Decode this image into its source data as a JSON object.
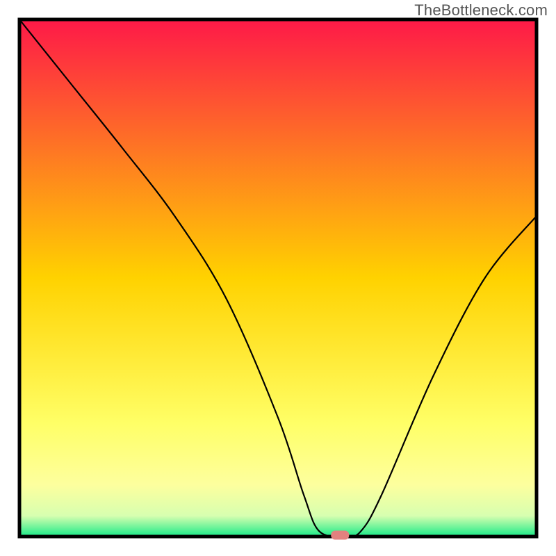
{
  "watermark": "TheBottleneck.com",
  "chart_data": {
    "type": "line",
    "title": "",
    "xlabel": "",
    "ylabel": "",
    "xlim": [
      0,
      100
    ],
    "ylim": [
      0,
      100
    ],
    "x": [
      0,
      10,
      20,
      30,
      40,
      50,
      55,
      58,
      63,
      66,
      70,
      80,
      90,
      100
    ],
    "values": [
      100,
      87.5,
      75,
      62,
      46,
      23,
      8,
      1,
      0,
      1,
      8,
      31,
      50,
      62
    ],
    "curve_description": "percentage bottleneck curve with minimum around x≈62",
    "min_marker": {
      "x": 62,
      "y": 0,
      "color": "#e2817f"
    },
    "background_gradient": {
      "stops": [
        {
          "offset": 0.0,
          "color": "#fe1948"
        },
        {
          "offset": 0.5,
          "color": "#ffd200"
        },
        {
          "offset": 0.78,
          "color": "#ffff66"
        },
        {
          "offset": 0.9,
          "color": "#fdff9e"
        },
        {
          "offset": 0.96,
          "color": "#d7ffb0"
        },
        {
          "offset": 1.0,
          "color": "#18ea88"
        }
      ]
    },
    "frame_color": "#000000",
    "frame_stroke_width": 5
  }
}
